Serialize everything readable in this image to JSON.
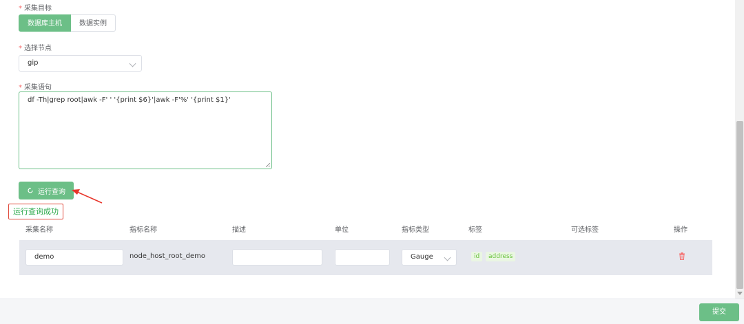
{
  "form": {
    "target_label": "采集目标",
    "target_options": [
      "数据库主机",
      "数据实例"
    ],
    "target_selected": "数据库主机",
    "node_label": "选择节点",
    "node_value": "gip",
    "statement_label": "采集语句",
    "statement_value": "df -Th|grep root|awk -F' ' '{print $6}'|awk -F'%' '{print $1}'",
    "run_button": "运行查询",
    "success_message": "运行查询成功"
  },
  "table": {
    "headers": [
      "采集名称",
      "指标名称",
      "描述",
      "单位",
      "指标类型",
      "标签",
      "可选标签",
      "操作"
    ],
    "row": {
      "collect_name": "demo",
      "metric_name": "node_host_root_demo",
      "description": "",
      "unit": "",
      "metric_type": "Gauge",
      "tags": [
        "id",
        "address"
      ],
      "optional_tags": ""
    }
  },
  "footer": {
    "submit": "提交"
  },
  "colors": {
    "primary": "#6cbf87",
    "danger": "#f56c6c",
    "tag_text": "#67c23a"
  },
  "icons": [
    "refresh-icon",
    "chevron-down-icon",
    "trash-icon",
    "arrow-annotation"
  ]
}
